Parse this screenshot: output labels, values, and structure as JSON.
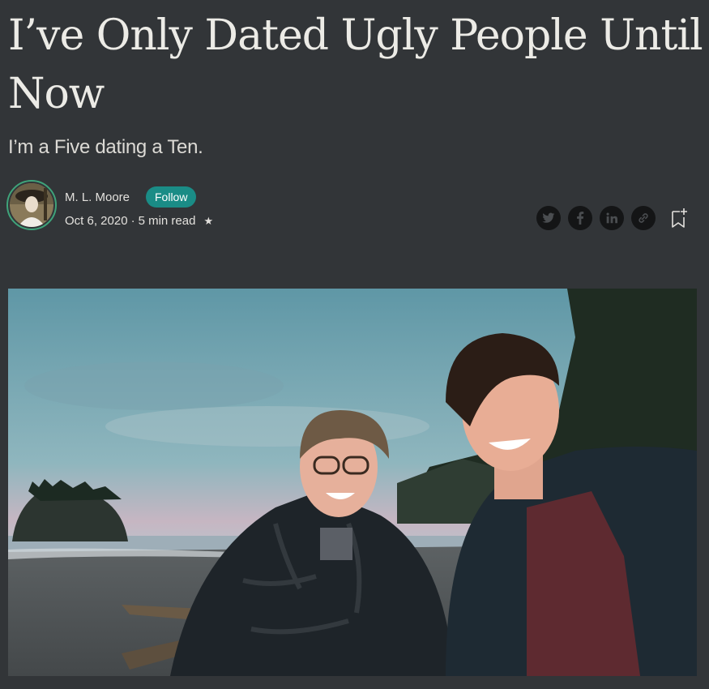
{
  "article": {
    "title": "I’ve Only Dated Ugly People Until Now",
    "subtitle": "I’m a Five dating a Ten."
  },
  "author": {
    "name": "M. L. Moore",
    "follow_label": "Follow",
    "date": "Oct 6, 2020",
    "separator": "·",
    "read_time": "5 min read",
    "member_star": "★"
  },
  "share": {
    "icons": [
      "twitter-icon",
      "facebook-icon",
      "linkedin-icon",
      "link-icon"
    ],
    "bookmark_icon": "bookmark-add-icon"
  },
  "colors": {
    "background": "#323538",
    "follow_button": "#1a8c86",
    "avatar_ring": "#3fa37a"
  }
}
